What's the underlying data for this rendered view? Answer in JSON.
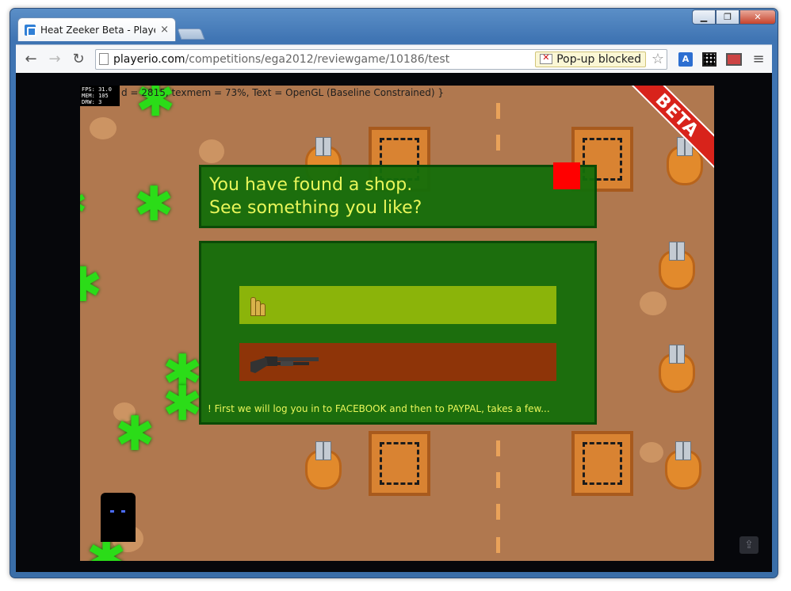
{
  "browser": {
    "tab_title": "Heat Zeeker Beta - PlayerJ",
    "tab_close": "×",
    "window_controls": {
      "minimize": "▁",
      "maximize": "❐",
      "close": "✕"
    },
    "url_host": "playerio.com",
    "url_path": "/competitions/ega2012/reviewgame/10186/test",
    "popup_blocked_label": "Pop-up blocked",
    "nav": {
      "back": "←",
      "forward": "→",
      "reload": "↻"
    },
    "star": "☆",
    "menu": "≡",
    "translate_label": "A"
  },
  "game": {
    "stats": [
      "FPS: 31.0",
      "MEM: 105",
      "DRW: 3"
    ],
    "debug_text": "d = 2815, texmem = 73%, Text = OpenGL (Baseline Constrained) }",
    "beta_label": "BETA",
    "shop": {
      "title_line1": "You have found a shop.",
      "title_line2": "See something you like?",
      "items": [
        {
          "name": "ammo",
          "icon": "ammo-icon"
        },
        {
          "name": "shotgun",
          "icon": "shotgun-icon"
        }
      ],
      "note": "! First we will log you in to FACEBOOK and then to PAYPAL, takes a few..."
    },
    "share_icon": "⇪"
  },
  "colors": {
    "ground": "#b0784f",
    "dialog_green": "#146e0a",
    "dialog_text": "#e8f65a",
    "ammo_bar": "#8bb40a",
    "shotgun_bar": "#8e3408",
    "close_red": "#ff0000",
    "beta_red": "#d8231b"
  }
}
